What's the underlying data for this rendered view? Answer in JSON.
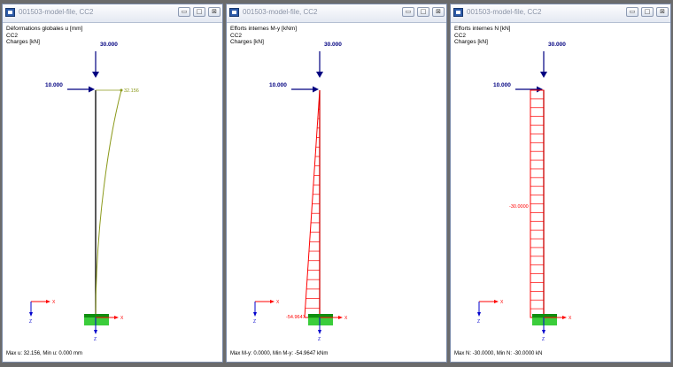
{
  "windows": [
    {
      "title": "001503-model-file, CC2",
      "info": [
        "Déformations globales u [mm]",
        "CC2",
        "Charges [kN]"
      ],
      "load_v": "30.000",
      "load_h": "10.000",
      "result_label": "32.156",
      "footer": "Max u: 32.156, Min u: 0.000 mm",
      "axis_x": "X",
      "axis_z": "Z"
    },
    {
      "title": "001503-model-file, CC2",
      "info": [
        "Efforts internes M-y [kNm]",
        "CC2",
        "Charges [kN]"
      ],
      "load_v": "30.000",
      "load_h": "10.000",
      "result_label": "-54.9647",
      "footer": "Max M-y: 0.0000, Min M-y: -54.9647 kNm",
      "axis_x": "X",
      "axis_z": "Z"
    },
    {
      "title": "001503-model-file, CC2",
      "info": [
        "Efforts internes N [kN]",
        "CC2",
        "Charges [kN]"
      ],
      "load_v": "30.000",
      "load_h": "10.000",
      "result_label": "-30.0000",
      "footer": "Max N: -30.0000, Min N: -30.0000 kN",
      "axis_x": "X",
      "axis_z": "Z"
    }
  ],
  "window_buttons": {
    "minimize": "▭",
    "maximize": "□",
    "close": "⊠"
  },
  "colors": {
    "load": "#000080",
    "deformation": "#8c9a1c",
    "moment": "#ff0000",
    "normal": "#ff0000",
    "member": "#000000",
    "support": "#19c419",
    "axis_x": "#ff0000",
    "axis_z": "#0000cc"
  }
}
